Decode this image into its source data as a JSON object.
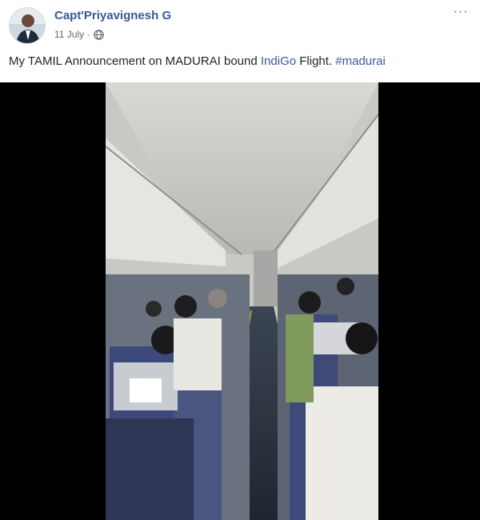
{
  "post": {
    "author_name": "Capt'Priyavignesh G",
    "timestamp": "11 July",
    "separator": "·",
    "privacy_icon": "globe-icon",
    "more_icon": "more-options-icon",
    "more_label": "···",
    "text": {
      "part1": "My TAMIL Announcement on MADURAI bound ",
      "link": "IndiGo",
      "part2": " Flight. ",
      "hashtag": "#madurai"
    }
  },
  "video": {
    "description_icon": "video-player"
  },
  "colors": {
    "link": "#385898",
    "text": "#1d2129",
    "secondary": "#616770",
    "video_bg": "#000000"
  }
}
